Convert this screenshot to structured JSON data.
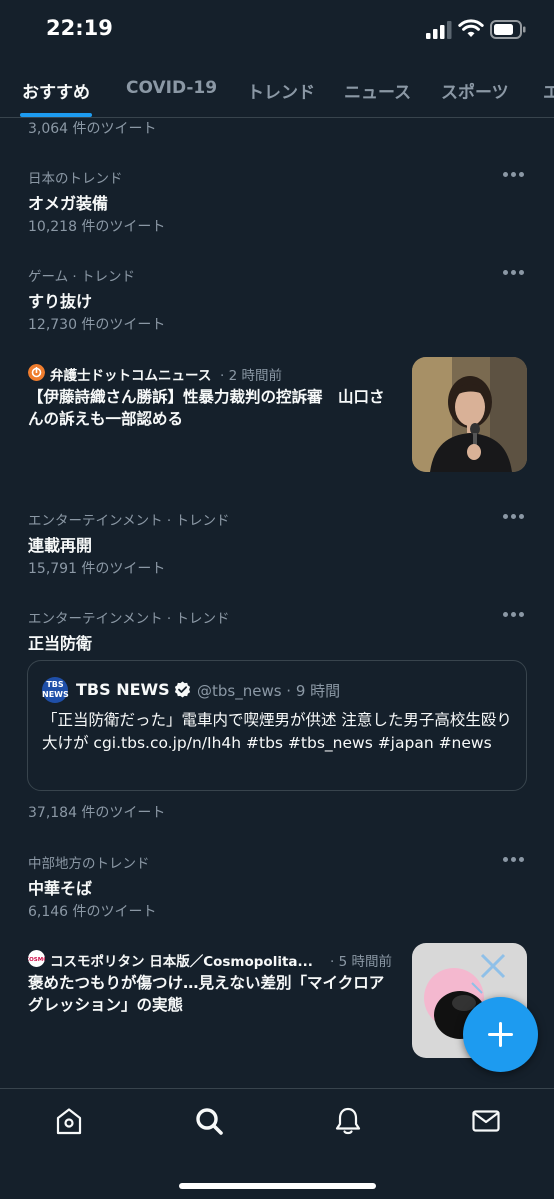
{
  "status_bar": {
    "time": "22:19"
  },
  "tabs": [
    {
      "label": "おすすめ",
      "active": true
    },
    {
      "label": "COVID-19",
      "active": false
    },
    {
      "label": "トレンド",
      "active": false
    },
    {
      "label": "ニュース",
      "active": false
    },
    {
      "label": "スポーツ",
      "active": false
    },
    {
      "label": "エ",
      "active": false
    }
  ],
  "feed": {
    "cut_off_count": "3,064 件のツイート",
    "trends": [
      {
        "context": "日本のトレンド",
        "name": "オメガ装備",
        "count": "10,218 件のツイート"
      },
      {
        "context": "ゲーム · トレンド",
        "name": "すり抜け",
        "count": "12,730 件のツイート"
      },
      {
        "context": "エンターテインメント · トレンド",
        "name": "連載再開",
        "count": "15,791 件のツイート"
      },
      {
        "context": "エンターテインメント · トレンド",
        "name": "正当防衛",
        "count": ""
      },
      {
        "context": "中部地方のトレンド",
        "name": "中華そば",
        "count": "6,146 件のツイート"
      }
    ],
    "news": [
      {
        "source": "弁護士ドットコムニュース",
        "time": "· 2 時間前",
        "headline": "【伊藤詩織さん勝訴】性暴力裁判の控訴審　山口さんの訴えも一部認める",
        "icon": "bengoshi-dotcom-logo"
      },
      {
        "source": "コスモポリタン 日本版／Cosmopolita...",
        "time": "· 5 時間前",
        "headline": "褒めたつもりが傷つけ…見えない差別「マイクロアグレッション」の実態",
        "icon": "cosmopolitan-logo"
      }
    ],
    "quoted_tweet": {
      "logo_text": "TBS NEWS",
      "name": "TBS NEWS",
      "handle": "@tbs_news · 9 時間",
      "text": "「正当防衛だった」電車内で喫煙男が供述 注意した男子高校生殴り大けが cgi.tbs.co.jp/n/Ih4h #tbs #tbs_news #japan #news"
    },
    "quoted_count": "37,184 件のツイート"
  },
  "bottom_nav": [
    "home-icon",
    "search-icon",
    "notifications-icon",
    "messages-icon"
  ],
  "colors": {
    "background": "#15202b",
    "accent": "#1d9bf0",
    "secondary_text": "#8b98a5",
    "divider": "#38444d"
  }
}
